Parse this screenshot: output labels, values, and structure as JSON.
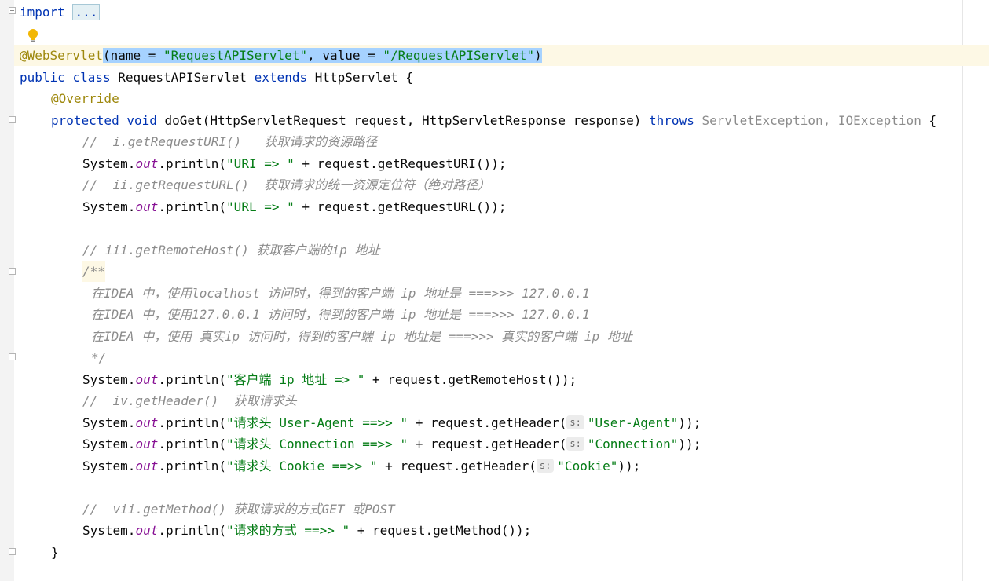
{
  "editor": {
    "lines": {
      "l1": {
        "kw": "import",
        "ellipsis": "..."
      },
      "l3": {
        "ann": "@WebServlet",
        "open": "(name = ",
        "name_val": "\"RequestAPIServlet\"",
        "mid": ", value = ",
        "value_val": "\"/RequestAPIServlet\"",
        "close": ")"
      },
      "l4": {
        "public": "public",
        "class": "class",
        "name": "RequestAPIServlet",
        "extends": "extends",
        "parent": "HttpServlet {"
      },
      "l5": {
        "ann": "@Override"
      },
      "l6": {
        "protected": "protected",
        "void": "void",
        "sig": "doGet(HttpServletRequest request, HttpServletResponse response)",
        "throws": "throws",
        "exc": "ServletException, IOException",
        "brace": " {"
      },
      "l7": {
        "comment": "//  i.getRequestURI()   获取请求的资源路径"
      },
      "l8": {
        "pre": "System.",
        "out": "out",
        "mid": ".println(",
        "str": "\"URI => \"",
        "post": " + request.getRequestURI());"
      },
      "l9": {
        "comment": "//  ii.getRequestURL()  获取请求的统一资源定位符（绝对路径）"
      },
      "l10": {
        "pre": "System.",
        "out": "out",
        "mid": ".println(",
        "str": "\"URL => \"",
        "post": " + request.getRequestURL());"
      },
      "l12": {
        "comment": "// iii.getRemoteHost() 获取客户端的ip 地址"
      },
      "l13": {
        "doc": "/**"
      },
      "l14": {
        "doc": "在IDEA 中，使用localhost 访问时，得到的客户端 ip 地址是 ===>>> 127.0.0.1"
      },
      "l15": {
        "doc": "在IDEA 中，使用127.0.0.1 访问时，得到的客户端 ip 地址是 ===>>> 127.0.0.1"
      },
      "l16": {
        "doc": "在IDEA 中，使用 真实ip 访问时，得到的客户端 ip 地址是 ===>>> 真实的客户端 ip 地址"
      },
      "l17": {
        "doc": "*/"
      },
      "l18": {
        "pre": "System.",
        "out": "out",
        "mid": ".println(",
        "str": "\"客户端 ip 地址 => \"",
        "post": " + request.getRemoteHost());"
      },
      "l19": {
        "comment": "//  iv.getHeader()  获取请求头"
      },
      "l20": {
        "pre": "System.",
        "out": "out",
        "mid": ".println(",
        "str": "\"请求头 User-Agent ==>> \"",
        "post1": " + request.getHeader(",
        "hint": "s:",
        "arg": "\"User-Agent\"",
        "post2": "));"
      },
      "l21": {
        "pre": "System.",
        "out": "out",
        "mid": ".println(",
        "str": "\"请求头 Connection ==>> \"",
        "post1": " + request.getHeader(",
        "hint": "s:",
        "arg": "\"Connection\"",
        "post2": "));"
      },
      "l22": {
        "pre": "System.",
        "out": "out",
        "mid": ".println(",
        "str": "\"请求头 Cookie ==>> \"",
        "post1": " + request.getHeader(",
        "hint": "s:",
        "arg": "\"Cookie\"",
        "post2": "));"
      },
      "l24": {
        "comment": "//  vii.getMethod() 获取请求的方式GET 或POST"
      },
      "l25": {
        "pre": "System.",
        "out": "out",
        "mid": ".println(",
        "str": "\"请求的方式 ==>> \"",
        "post": " + request.getMethod());"
      },
      "l26": {
        "brace": "}"
      }
    },
    "colors": {
      "keyword": "#0033b3",
      "annotation": "#9e880d",
      "string": "#067d17",
      "static_field": "#871094",
      "comment": "#8c8c8c",
      "selection": "#a6d2ff",
      "caret_line": "#fdf8e5"
    },
    "icons": {
      "intention": "lightbulb-icon",
      "fold": "fold-toggle-icon"
    }
  }
}
